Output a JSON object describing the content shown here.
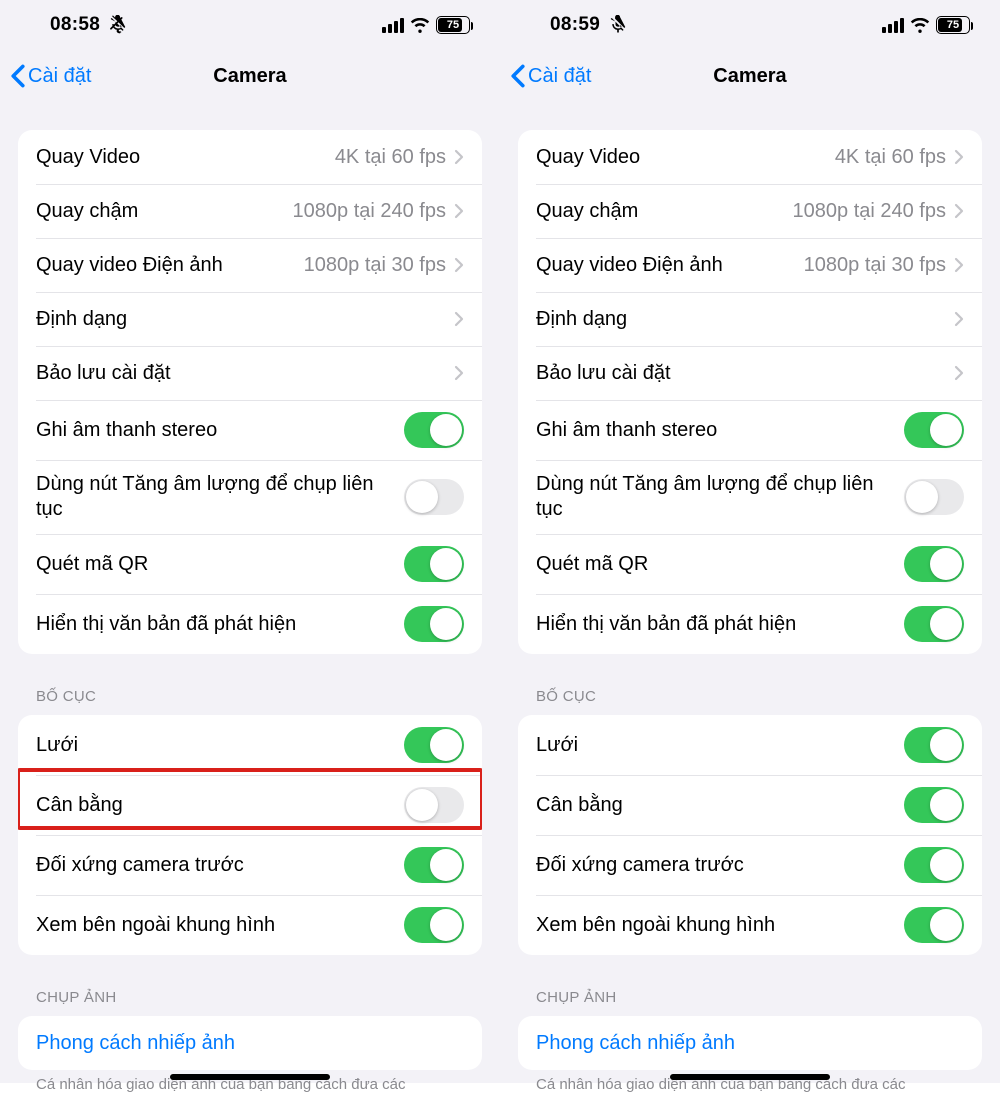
{
  "panes": [
    {
      "status": {
        "time": "08:58",
        "battery_pct": "75"
      },
      "nav": {
        "back_label": "Cài đặt",
        "title": "Camera"
      },
      "group1": [
        {
          "label": "Quay Video",
          "value": "4K tại 60 fps",
          "type": "nav"
        },
        {
          "label": "Quay chậm",
          "value": "1080p tại 240 fps",
          "type": "nav"
        },
        {
          "label": "Quay video Điện ảnh",
          "value": "1080p tại 30 fps",
          "type": "nav"
        },
        {
          "label": "Định dạng",
          "type": "nav"
        },
        {
          "label": "Bảo lưu cài đặt",
          "type": "nav"
        },
        {
          "label": "Ghi âm thanh stereo",
          "type": "switch",
          "on": true
        },
        {
          "label": "Dùng nút Tăng âm lượng để chụp liên tục",
          "type": "switch",
          "on": false
        },
        {
          "label": "Quét mã QR",
          "type": "switch",
          "on": true
        },
        {
          "label": "Hiển thị văn bản đã phát hiện",
          "type": "switch",
          "on": true
        }
      ],
      "layout_header": "BỐ CỤC",
      "group2": [
        {
          "label": "Lưới",
          "type": "switch",
          "on": true
        },
        {
          "label": "Cân bằng",
          "type": "switch",
          "on": false,
          "highlight": true
        },
        {
          "label": "Đối xứng camera trước",
          "type": "switch",
          "on": true
        },
        {
          "label": "Xem bên ngoài khung hình",
          "type": "switch",
          "on": true
        }
      ],
      "capture_header": "CHỤP ẢNH",
      "group3_link": "Phong cách nhiếp ảnh",
      "footer": "Cá nhân hóa giao diện ảnh của bạn bằng cách đưa các"
    },
    {
      "status": {
        "time": "08:59",
        "battery_pct": "75"
      },
      "nav": {
        "back_label": "Cài đặt",
        "title": "Camera"
      },
      "group1": [
        {
          "label": "Quay Video",
          "value": "4K tại 60 fps",
          "type": "nav"
        },
        {
          "label": "Quay chậm",
          "value": "1080p tại 240 fps",
          "type": "nav"
        },
        {
          "label": "Quay video Điện ảnh",
          "value": "1080p tại 30 fps",
          "type": "nav"
        },
        {
          "label": "Định dạng",
          "type": "nav"
        },
        {
          "label": "Bảo lưu cài đặt",
          "type": "nav"
        },
        {
          "label": "Ghi âm thanh stereo",
          "type": "switch",
          "on": true
        },
        {
          "label": "Dùng nút Tăng âm lượng để chụp liên tục",
          "type": "switch",
          "on": false
        },
        {
          "label": "Quét mã QR",
          "type": "switch",
          "on": true
        },
        {
          "label": "Hiển thị văn bản đã phát hiện",
          "type": "switch",
          "on": true
        }
      ],
      "layout_header": "BỐ CỤC",
      "group2": [
        {
          "label": "Lưới",
          "type": "switch",
          "on": true
        },
        {
          "label": "Cân bằng",
          "type": "switch",
          "on": true
        },
        {
          "label": "Đối xứng camera trước",
          "type": "switch",
          "on": true
        },
        {
          "label": "Xem bên ngoài khung hình",
          "type": "switch",
          "on": true
        }
      ],
      "capture_header": "CHỤP ẢNH",
      "group3_link": "Phong cách nhiếp ảnh",
      "footer": "Cá nhân hóa giao diện ảnh của bạn bằng cách đưa các"
    }
  ]
}
